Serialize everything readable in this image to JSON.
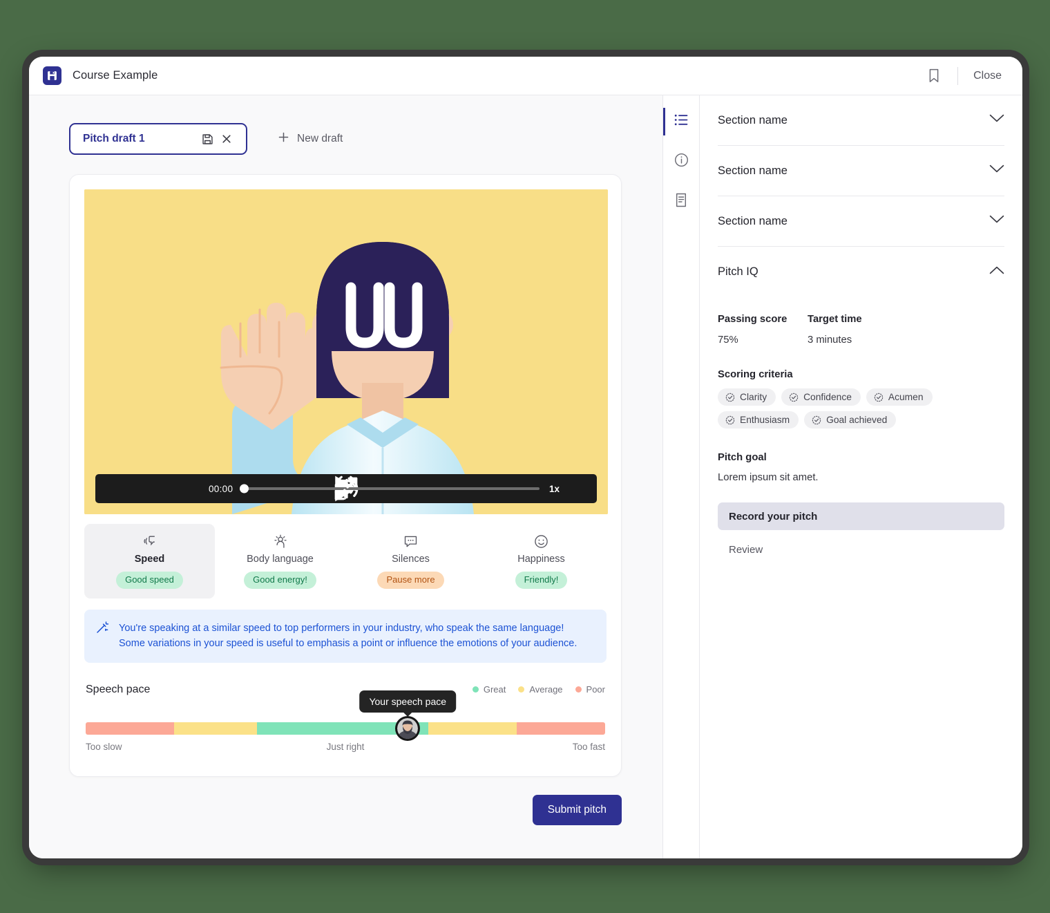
{
  "window": {
    "app_icon": "save-disk-icon",
    "title": "Course Example",
    "bookmark_icon": "bookmark-icon",
    "close_label": "Close"
  },
  "drafts": {
    "active_name": "Pitch draft 1",
    "save_icon": "floppy-save-icon",
    "close_icon": "close-x-icon",
    "new_draft_label": "New draft",
    "plus_icon": "plus-icon"
  },
  "player": {
    "play_icon": "play-icon",
    "rewind_label": "5",
    "forward_label": "5",
    "volume_icon": "volume-icon",
    "current_time": "00:00",
    "speed_label": "1x",
    "fullscreen_icon": "expand-icon",
    "progress_percent": 0
  },
  "metrics": [
    {
      "icon": "speech-wave-icon",
      "label": "Speed",
      "badge": "Good speed",
      "badge_tone": "green",
      "active": true
    },
    {
      "icon": "body-language-icon",
      "label": "Body language",
      "badge": "Good energy!",
      "badge_tone": "green",
      "active": false
    },
    {
      "icon": "speech-bubble-icon",
      "label": "Silences",
      "badge": "Pause more",
      "badge_tone": "orange",
      "active": false
    },
    {
      "icon": "smiley-icon",
      "label": "Happiness",
      "badge": "Friendly!",
      "badge_tone": "green",
      "active": false
    }
  ],
  "tip": {
    "icon": "magic-wand-icon",
    "line1": "You're speaking at a similar speed to top performers in your industry, who speak the same language!",
    "line2": "Some variations in your speed is useful to emphasis a point or influence the emotions of your audience."
  },
  "chart_data": {
    "type": "bar",
    "title": "Speech pace",
    "xlabel": "",
    "ylabel": "",
    "orientation": "horizontal-band",
    "legend_position": "top-right",
    "legend": [
      {
        "label": "Great",
        "color": "#7fe3b8"
      },
      {
        "label": "Average",
        "color": "#fbe188"
      },
      {
        "label": "Poor",
        "color": "#fca896"
      }
    ],
    "categories": [
      "Poor (slow)",
      "Average (slow)",
      "Great",
      "Average (fast)",
      "Poor (fast)"
    ],
    "values": [
      17,
      16,
      33,
      17,
      17
    ],
    "segments": [
      {
        "label": "Poor",
        "width_percent": 17,
        "color": "#fca896"
      },
      {
        "label": "Average",
        "width_percent": 16,
        "color": "#fbe188"
      },
      {
        "label": "Great",
        "width_percent": 33,
        "color": "#7fe3b8"
      },
      {
        "label": "Average",
        "width_percent": 17,
        "color": "#fbe188"
      },
      {
        "label": "Poor",
        "width_percent": 17,
        "color": "#fca896"
      }
    ],
    "marker": {
      "label": "Your speech pace",
      "position_percent": 62,
      "zone": "Great"
    },
    "axis_labels": {
      "left": "Too slow",
      "center": "Just right",
      "right": "Too fast"
    }
  },
  "pace": {
    "title": "Speech pace",
    "tooltip": "Your speech pace",
    "label_left": "Too slow",
    "label_center": "Just right",
    "label_right": "Too fast"
  },
  "submit": {
    "label": "Submit pitch"
  },
  "rail": [
    {
      "icon": "list-icon",
      "active": true
    },
    {
      "icon": "info-circle-icon",
      "active": false
    },
    {
      "icon": "document-icon",
      "active": false
    }
  ],
  "sections": [
    {
      "title": "Section name",
      "open": false
    },
    {
      "title": "Section name",
      "open": false
    },
    {
      "title": "Section name",
      "open": false
    }
  ],
  "pitch_iq": {
    "title": "Pitch IQ",
    "open": true,
    "passing_score_label": "Passing score",
    "passing_score_value": "75%",
    "target_time_label": "Target time",
    "target_time_value": "3 minutes",
    "scoring_criteria_label": "Scoring criteria",
    "criteria": [
      "Clarity",
      "Confidence",
      "Acumen",
      "Enthusiasm",
      "Goal achieved"
    ],
    "criteria_icon": "check-badge-icon",
    "pitch_goal_label": "Pitch goal",
    "pitch_goal_text": "Lorem ipsum sit amet.",
    "steps": [
      {
        "label": "Record your pitch",
        "current": true
      },
      {
        "label": "Review",
        "current": false
      }
    ]
  },
  "colors": {
    "brand": "#2f3192",
    "great": "#7fe3b8",
    "average": "#fbe188",
    "poor": "#fca896",
    "tip_bg": "#e9f1fe",
    "tip_text": "#1c52d4",
    "page_bg": "#4a6b47"
  }
}
